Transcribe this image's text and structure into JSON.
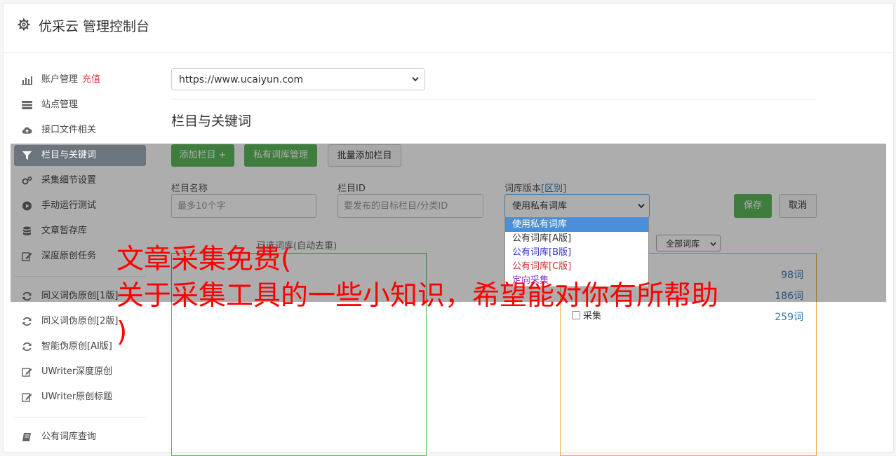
{
  "header": {
    "title": "优采云 管理控制台"
  },
  "sidebar": {
    "items": [
      {
        "label": "账户管理",
        "extra": "充值",
        "icon": "bar-chart-icon"
      },
      {
        "label": "站点管理",
        "icon": "server-icon"
      },
      {
        "label": "接口文件相关",
        "icon": "cloud-upload-icon"
      },
      {
        "label": "栏目与关键词",
        "icon": "filter-icon",
        "active": true
      },
      {
        "label": "采集细节设置",
        "icon": "cogs-icon"
      },
      {
        "label": "手动运行测试",
        "icon": "play-circle-icon"
      },
      {
        "label": "文章暂存库",
        "icon": "database-icon"
      },
      {
        "label": "深度原创任务",
        "icon": "edit-icon"
      },
      {
        "label": "同义词伪原创[1版]",
        "icon": "refresh-icon"
      },
      {
        "label": "同义词伪原创[2版]",
        "icon": "refresh-icon"
      },
      {
        "label": "智能伪原创[AI版]",
        "icon": "refresh-icon"
      },
      {
        "label": "UWriter深度原创",
        "icon": "edit-icon"
      },
      {
        "label": "UWriter原创标题",
        "icon": "edit-icon"
      },
      {
        "label": "公有词库查询",
        "icon": "book-icon"
      }
    ]
  },
  "main": {
    "site_select": "https://www.ucaiyun.com",
    "section_title": "栏目与关键词",
    "buttons": {
      "add_column": "添加栏目 +",
      "private_lib": "私有词库管理",
      "batch_add": "批量添加栏目",
      "save": "保存",
      "cancel": "取消"
    },
    "fields": {
      "name_label": "栏目名称",
      "name_placeholder": "最多10个字",
      "id_label": "栏目ID",
      "id_placeholder": "要发布的目标栏目/分类ID",
      "lib_label": "词库版本",
      "lib_diff": "[区别]",
      "lib_selected": "使用私有词库"
    },
    "dropdown_options": [
      {
        "label": "使用私有词库",
        "color": "#ffffff"
      },
      {
        "label": "公有词库[A版]",
        "color": "#333333"
      },
      {
        "label": "公有词库[B版]",
        "color": "#3333cc"
      },
      {
        "label": "公有词库[C版]",
        "color": "#cc3333"
      },
      {
        "label": "定向采集",
        "color": "#8833cc"
      }
    ],
    "selected_caption": "已选词库(自动去重)",
    "all_libs": "全部词库",
    "right_panel": {
      "counts": [
        "98词",
        "186词",
        "259词"
      ],
      "check_label": "采集"
    }
  },
  "overlay": {
    "text": "文章采集免费(\n关于采集工具的一些小知识，希望能对你有所帮助\n)"
  },
  "colors": {
    "accent_green": "#5cb85c",
    "active_bg": "#6c757d",
    "overlay_text": "#ff0000"
  }
}
